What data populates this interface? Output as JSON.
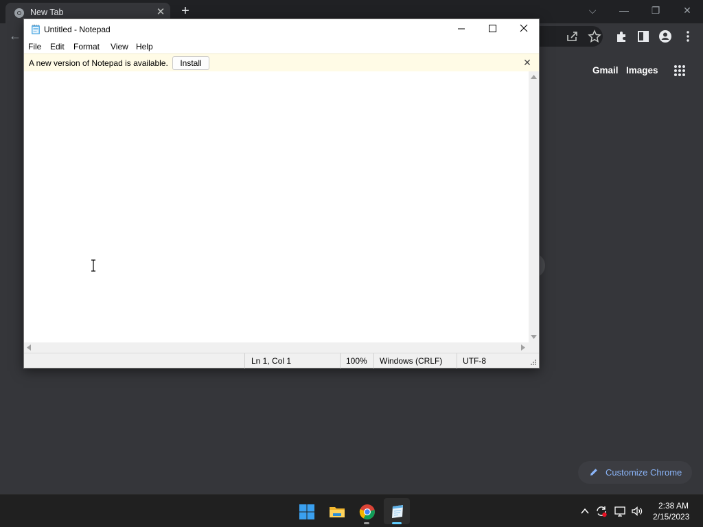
{
  "chrome": {
    "tab_title": "New Tab",
    "tab_close": "✕",
    "new_tab": "+",
    "tab_list": "⌵",
    "minimize": "—",
    "restore": "❐",
    "close": "✕",
    "back": "←",
    "gmail_label": "Gmail",
    "images_label": "Images",
    "customize_label": "Customize Chrome",
    "accent_color": "#8ab4f8",
    "toolbar_icons": [
      "share-icon",
      "bookmark-star-icon",
      "extensions-icon",
      "side-panel-icon",
      "profile-icon",
      "more-menu-icon"
    ]
  },
  "notepad": {
    "title": "Untitled - Notepad",
    "menu": [
      "File",
      "Edit",
      "Format",
      "View",
      "Help"
    ],
    "infobar_text": "A new version of Notepad is available.",
    "install_label": "Install",
    "infobar_close": "✕",
    "infobar_color": "#fffbe6",
    "status": {
      "position": "Ln 1, Col 1",
      "zoom": "100%",
      "line_ending": "Windows (CRLF)",
      "encoding": "UTF-8"
    }
  },
  "taskbar": {
    "apps": [
      "windows-start-icon",
      "file-explorer-icon",
      "chrome-icon",
      "notepad-icon"
    ],
    "tray": [
      "show-hidden-icons-icon",
      "sync-icon",
      "network-icon",
      "volume-icon"
    ],
    "time": "2:38 AM",
    "date": "2/15/2023"
  }
}
